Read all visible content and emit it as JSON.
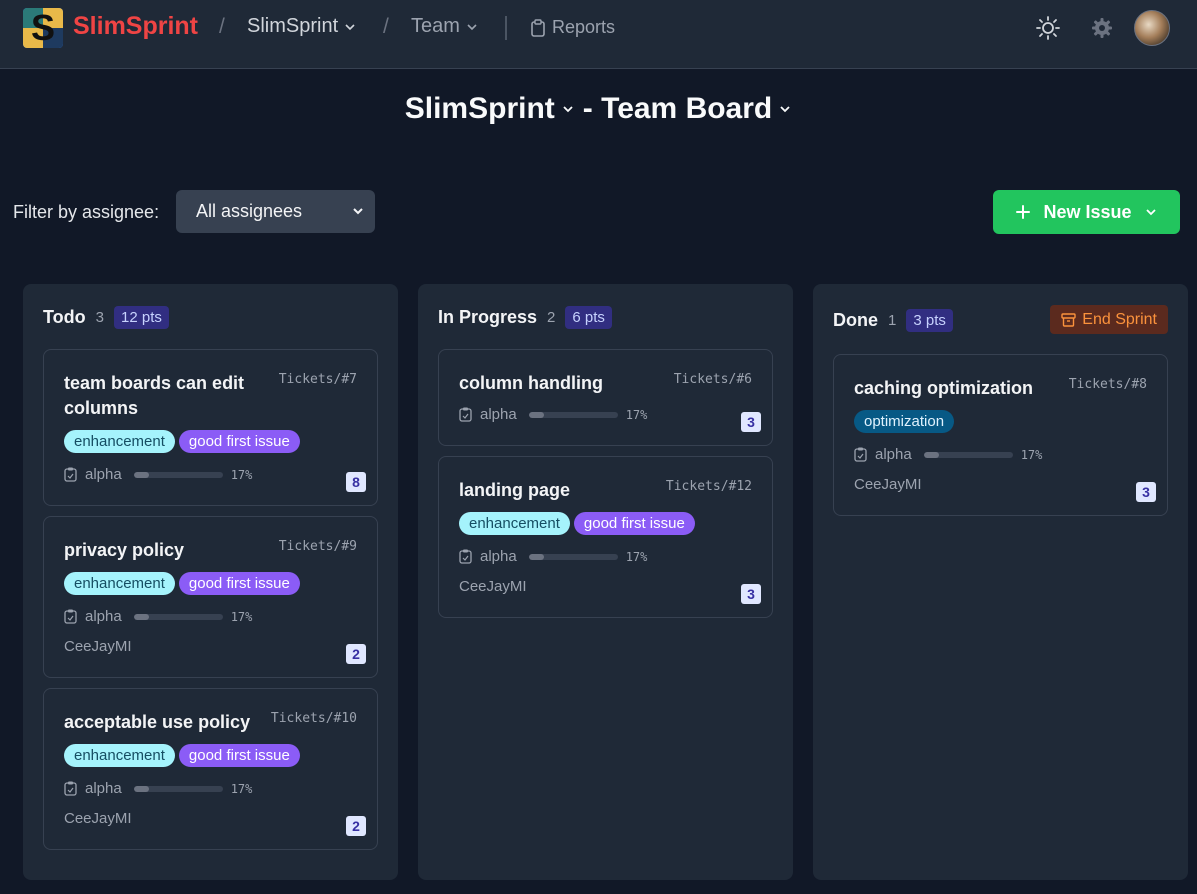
{
  "nav": {
    "brand": "SlimSprint",
    "logo_letter": "S",
    "project_crumb": "SlimSprint",
    "team_crumb": "Team",
    "reports": "Reports"
  },
  "board": {
    "project": "SlimSprint",
    "separator": "- Team Board"
  },
  "filter": {
    "label": "Filter by assignee:",
    "selected": "All assignees"
  },
  "new_issue": "New Issue",
  "columns": [
    {
      "title": "Todo",
      "count": "3",
      "points": "12 pts",
      "cards": [
        {
          "title": "team boards can edit columns",
          "id": "Tickets/#7",
          "labels": [
            "enhancement",
            "good first issue"
          ],
          "sprint": "alpha",
          "progress": 0.17,
          "progress_text": "17%",
          "assignee": "",
          "estimate": "8"
        },
        {
          "title": "privacy policy",
          "id": "Tickets/#9",
          "labels": [
            "enhancement",
            "good first issue"
          ],
          "sprint": "alpha",
          "progress": 0.17,
          "progress_text": "17%",
          "assignee": "CeeJayMI",
          "estimate": "2"
        },
        {
          "title": "acceptable use policy",
          "id": "Tickets/#10",
          "labels": [
            "enhancement",
            "good first issue"
          ],
          "sprint": "alpha",
          "progress": 0.17,
          "progress_text": "17%",
          "assignee": "CeeJayMI",
          "estimate": "2"
        }
      ]
    },
    {
      "title": "In Progress",
      "count": "2",
      "points": "6 pts",
      "cards": [
        {
          "title": "column handling",
          "id": "Tickets/#6",
          "labels": [],
          "sprint": "alpha",
          "progress": 0.17,
          "progress_text": "17%",
          "assignee": "",
          "estimate": "3"
        },
        {
          "title": "landing page",
          "id": "Tickets/#12",
          "labels": [
            "enhancement",
            "good first issue"
          ],
          "sprint": "alpha",
          "progress": 0.17,
          "progress_text": "17%",
          "assignee": "CeeJayMI",
          "estimate": "3"
        }
      ]
    },
    {
      "title": "Done",
      "count": "1",
      "points": "3 pts",
      "action": "End Sprint",
      "cards": [
        {
          "title": "caching optimization",
          "id": "Tickets/#8",
          "labels": [
            "optimization"
          ],
          "sprint": "alpha",
          "progress": 0.17,
          "progress_text": "17%",
          "assignee": "CeeJayMI",
          "estimate": "3"
        }
      ]
    }
  ]
}
